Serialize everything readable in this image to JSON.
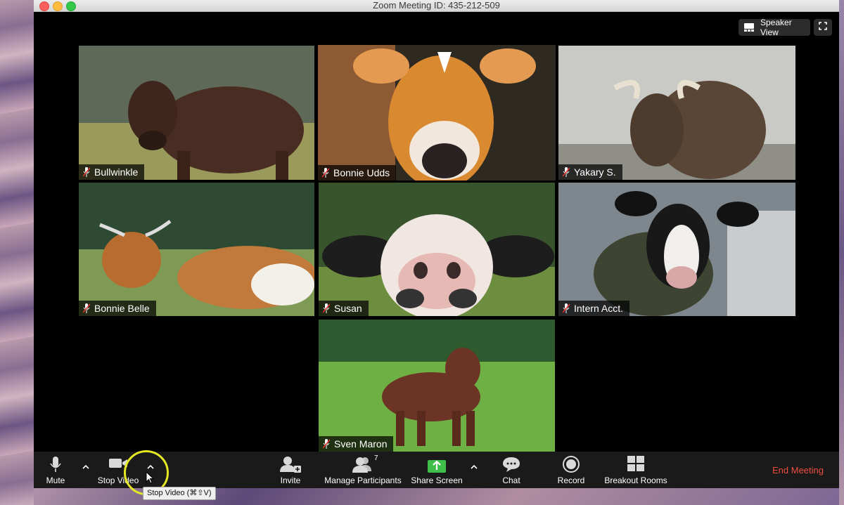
{
  "window": {
    "title": "Zoom Meeting ID: 435-212-509"
  },
  "view_controls": {
    "speaker_view_label": "Speaker View",
    "speaker_view_icon": "speaker-view-icon",
    "fullscreen_icon": "fullscreen-icon"
  },
  "participants": [
    {
      "name": "Bullwinkle",
      "muted": true,
      "active": false
    },
    {
      "name": "Bonnie Udds",
      "muted": true,
      "active": true
    },
    {
      "name": "Yakary S.",
      "muted": true,
      "active": false
    },
    {
      "name": "Bonnie Belle",
      "muted": true,
      "active": false
    },
    {
      "name": "Susan",
      "muted": true,
      "active": false
    },
    {
      "name": "Intern Acct.",
      "muted": true,
      "active": false
    },
    {
      "name": "Sven Maron",
      "muted": true,
      "active": false
    }
  ],
  "toolbar": {
    "mute_label": "Mute",
    "stop_video_label": "Stop Video",
    "invite_label": "Invite",
    "manage_participants_label": "Manage Participants",
    "participant_count": "7",
    "share_screen_label": "Share Screen",
    "chat_label": "Chat",
    "record_label": "Record",
    "breakout_rooms_label": "Breakout Rooms",
    "end_meeting_label": "End Meeting"
  },
  "tooltip": {
    "text": "Stop Video (⌘⇧V)"
  },
  "colors": {
    "active_speaker_border": "#c6e07a",
    "share_screen_green": "#3fbf4a",
    "end_meeting_red": "#ef4c3f",
    "highlight_ring": "#e5e624"
  }
}
